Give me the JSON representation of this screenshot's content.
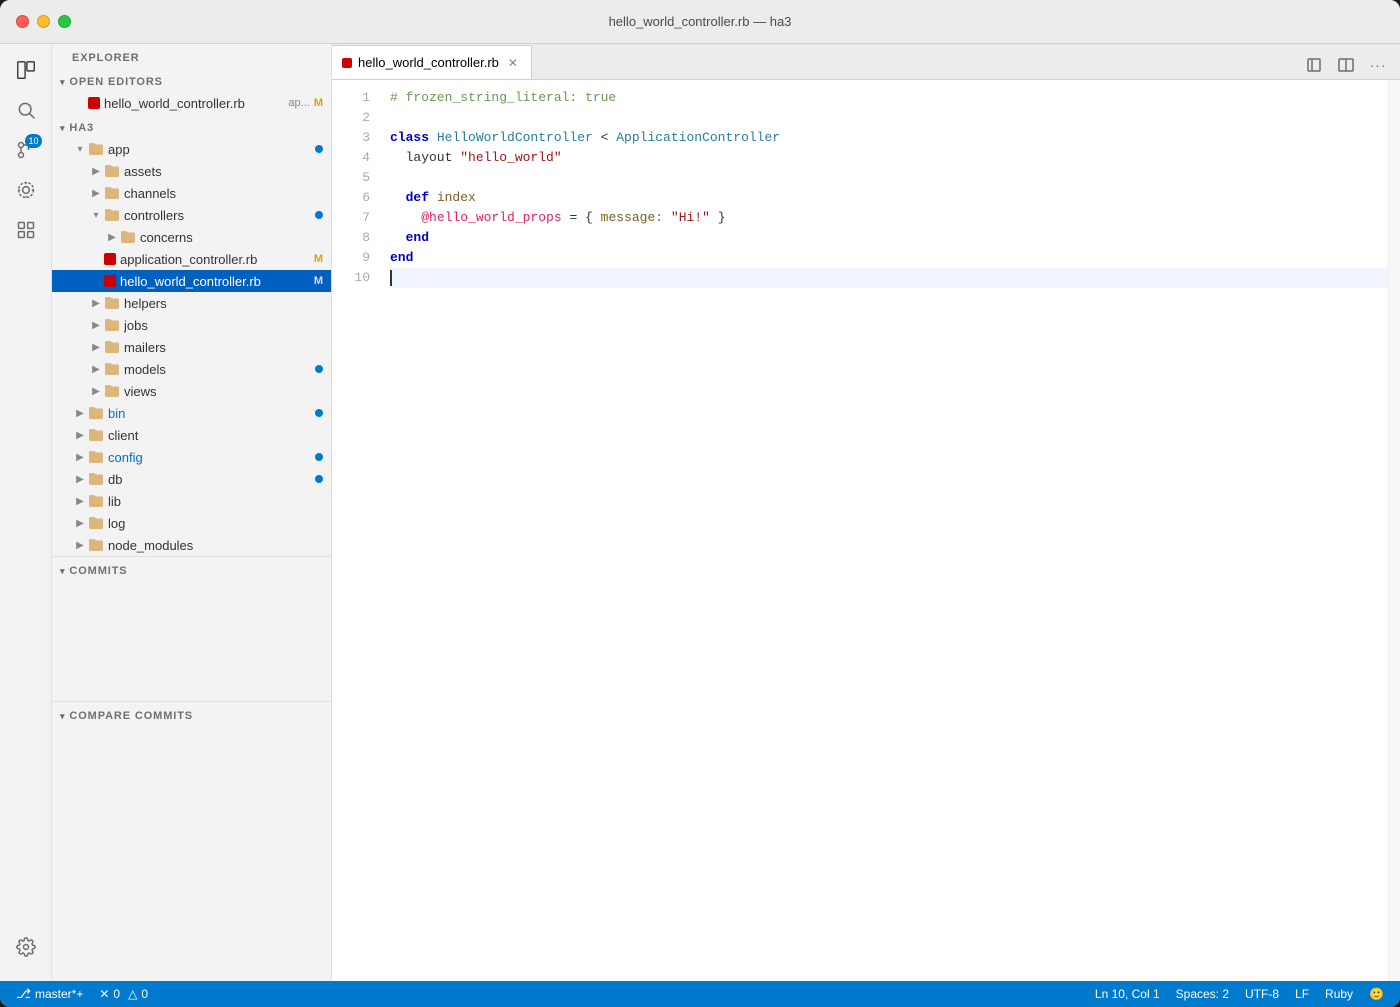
{
  "window": {
    "title": "hello_world_controller.rb — ha3"
  },
  "titlebar": {
    "title": "hello_world_controller.rb — ha3"
  },
  "activityBar": {
    "icons": [
      {
        "name": "explorer-icon",
        "symbol": "⎘",
        "active": true,
        "badge": null
      },
      {
        "name": "search-icon",
        "symbol": "🔍",
        "active": false,
        "badge": null
      },
      {
        "name": "source-control-icon",
        "symbol": "⑂",
        "active": false,
        "badge": "10"
      },
      {
        "name": "debug-icon",
        "symbol": "⊙",
        "active": false,
        "badge": null
      },
      {
        "name": "extensions-icon",
        "symbol": "⊞",
        "active": false,
        "badge": null
      }
    ],
    "bottomIcons": [
      {
        "name": "settings-icon",
        "symbol": "⚙",
        "active": false
      }
    ]
  },
  "sidebar": {
    "explorer_label": "EXPLORER",
    "open_editors_label": "OPEN EDITORS",
    "open_editors_files": [
      {
        "name": "hello_world_controller.rb",
        "short": "ap...",
        "modified": "M",
        "selected": false
      }
    ],
    "project_name": "HA3",
    "tree": [
      {
        "label": "app",
        "type": "folder",
        "indent": 0,
        "expanded": true,
        "badge": true
      },
      {
        "label": "assets",
        "type": "folder",
        "indent": 1,
        "expanded": false
      },
      {
        "label": "channels",
        "type": "folder",
        "indent": 1,
        "expanded": false
      },
      {
        "label": "controllers",
        "type": "folder",
        "indent": 1,
        "expanded": true,
        "badge": true
      },
      {
        "label": "concerns",
        "type": "folder",
        "indent": 2,
        "expanded": false
      },
      {
        "label": "application_controller.rb",
        "type": "ruby",
        "indent": 2,
        "modified": "M"
      },
      {
        "label": "hello_world_controller.rb",
        "type": "ruby",
        "indent": 2,
        "modified": "M",
        "selected": true
      },
      {
        "label": "helpers",
        "type": "folder",
        "indent": 1,
        "expanded": false
      },
      {
        "label": "jobs",
        "type": "folder",
        "indent": 1,
        "expanded": false
      },
      {
        "label": "mailers",
        "type": "folder",
        "indent": 1,
        "expanded": false
      },
      {
        "label": "models",
        "type": "folder",
        "indent": 1,
        "expanded": false,
        "badge": true
      },
      {
        "label": "views",
        "type": "folder",
        "indent": 1,
        "expanded": false
      },
      {
        "label": "bin",
        "type": "folder",
        "indent": 0,
        "expanded": false,
        "badge": true
      },
      {
        "label": "client",
        "type": "folder",
        "indent": 0,
        "expanded": false
      },
      {
        "label": "config",
        "type": "folder",
        "indent": 0,
        "expanded": false,
        "badge": true
      },
      {
        "label": "db",
        "type": "folder",
        "indent": 0,
        "expanded": false,
        "badge": true
      },
      {
        "label": "lib",
        "type": "folder",
        "indent": 0,
        "expanded": false
      },
      {
        "label": "log",
        "type": "folder",
        "indent": 0,
        "expanded": false
      },
      {
        "label": "node_modules",
        "type": "folder",
        "indent": 0,
        "expanded": false
      }
    ],
    "commits_label": "COMMITS",
    "compare_commits_label": "COMPARE COMMITS"
  },
  "editor": {
    "tab_label": "hello_world_controller.rb",
    "lines": [
      {
        "num": 1,
        "tokens": [
          {
            "type": "comment",
            "text": "# frozen_string_literal: true"
          }
        ]
      },
      {
        "num": 2,
        "tokens": []
      },
      {
        "num": 3,
        "tokens": [
          {
            "type": "keyword",
            "text": "class "
          },
          {
            "type": "class-name",
            "text": "HelloWorldController"
          },
          {
            "type": "plain",
            "text": " < "
          },
          {
            "type": "class-name",
            "text": "ApplicationController"
          }
        ]
      },
      {
        "num": 4,
        "tokens": [
          {
            "type": "plain",
            "text": "  layout "
          },
          {
            "type": "string",
            "text": "\"hello_world\""
          }
        ]
      },
      {
        "num": 5,
        "tokens": []
      },
      {
        "num": 6,
        "tokens": [
          {
            "type": "plain",
            "text": "  "
          },
          {
            "type": "keyword",
            "text": "def "
          },
          {
            "type": "method",
            "text": "index"
          }
        ]
      },
      {
        "num": 7,
        "tokens": [
          {
            "type": "plain",
            "text": "    "
          },
          {
            "type": "ivar",
            "text": "@hello_world_props"
          },
          {
            "type": "plain",
            "text": " = { "
          },
          {
            "type": "symbol",
            "text": "message:"
          },
          {
            "type": "plain",
            "text": " "
          },
          {
            "type": "string",
            "text": "\"Hi!\""
          },
          {
            "type": "plain",
            "text": " }"
          }
        ]
      },
      {
        "num": 8,
        "tokens": [
          {
            "type": "plain",
            "text": "  "
          },
          {
            "type": "keyword",
            "text": "end"
          }
        ]
      },
      {
        "num": 9,
        "tokens": [
          {
            "type": "keyword",
            "text": "end"
          }
        ]
      },
      {
        "num": 10,
        "tokens": []
      }
    ]
  },
  "statusBar": {
    "branch": "master*+",
    "errors": "0",
    "warnings": "0",
    "position": "Ln 10, Col 1",
    "spaces": "Spaces: 2",
    "encoding": "UTF-8",
    "line_ending": "LF",
    "language": "Ruby",
    "error_icon": "✕",
    "warning_icon": "△",
    "branch_icon": "⎇",
    "face_icon": "🙂"
  }
}
